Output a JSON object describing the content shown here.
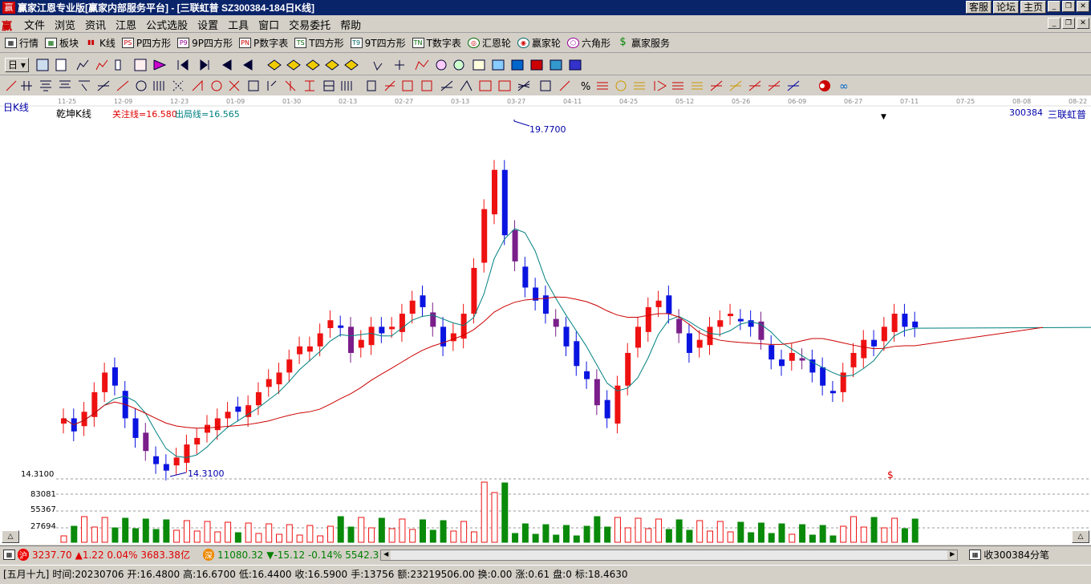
{
  "window": {
    "title": "赢家江恩专业版[赢家内部服务平台] - [三联虹普  SZ300384-184日K线]",
    "buttons": [
      "客服",
      "论坛",
      "主页"
    ]
  },
  "menu": [
    "文件",
    "浏览",
    "资讯",
    "江恩",
    "公式选股",
    "设置",
    "工具",
    "窗口",
    "交易委托",
    "帮助"
  ],
  "toolbar1": [
    {
      "label": "行情",
      "icon": "grid-icon"
    },
    {
      "label": "板块",
      "icon": "blocks-icon"
    },
    {
      "label": "K线",
      "icon": "candle-icon"
    },
    {
      "label": "P四方形",
      "icon": "ps-icon",
      "badge": "PS"
    },
    {
      "label": "9P四方形",
      "icon": "p9-icon",
      "badge": "P9"
    },
    {
      "label": "P数字表",
      "icon": "pn-icon",
      "badge": "PN"
    },
    {
      "label": "T四方形",
      "icon": "ts-icon",
      "badge": "TS"
    },
    {
      "label": "9T四方形",
      "icon": "t9-icon",
      "badge": "T9"
    },
    {
      "label": "T数字表",
      "icon": "tn-icon",
      "badge": "TN"
    },
    {
      "label": "汇恩轮",
      "icon": "wheel-icon"
    },
    {
      "label": "赢家轮",
      "icon": "wheel2-icon"
    },
    {
      "label": "六角形",
      "icon": "hexagon-icon"
    },
    {
      "label": "赢家服务",
      "icon": "dollar-icon"
    }
  ],
  "chart": {
    "period_label": "日K线",
    "indicator_name": "乾坤K线",
    "focus_line": "关注线=16.580",
    "exit_line": "出局线=16.565",
    "symbol_code": "300384",
    "symbol_name": "三联虹普",
    "high_label": "19.7700",
    "low_label": "14.3100",
    "axis_price": "14.3100",
    "vol_ticks": [
      "83081",
      "55367",
      "27694"
    ],
    "dollar_mark": "$",
    "dates": [
      "11-25",
      "12-09",
      "12-23",
      "01-09",
      "01-30",
      "02-13",
      "02-27",
      "03-13",
      "03-27",
      "04-11",
      "04-25",
      "05-12",
      "05-26",
      "06-09",
      "06-27",
      "07-11",
      "07-25",
      "08-08",
      "08-22"
    ]
  },
  "chart_data": {
    "type": "candlestick",
    "title": "",
    "price_range": [
      14.31,
      19.77
    ],
    "last_close": 16.59,
    "focus_line": 16.58,
    "exit_line": 16.565
  },
  "indexes": {
    "sh_badge": "沪",
    "sh_value": "3237.70",
    "sh_change": "▲1.22 0.04% 3683.38亿",
    "sz_badge": "深",
    "sz_value": "11080.32",
    "sz_change": "▼-15.12 -0.14% 5542.3",
    "tick_label": "收300384分笔"
  },
  "status": {
    "lunar": "[五月十九]",
    "time": "时间:20230706",
    "open": "开:16.4800",
    "high": "高:16.6700",
    "low": "低:16.4400",
    "close": "收:16.5900",
    "hands": "手:13756",
    "amount": "额:23219506.00",
    "turnover": "换:0.00",
    "rise": "涨:0.61",
    "pan": "盘:0",
    "mark": "标:18.4630"
  }
}
